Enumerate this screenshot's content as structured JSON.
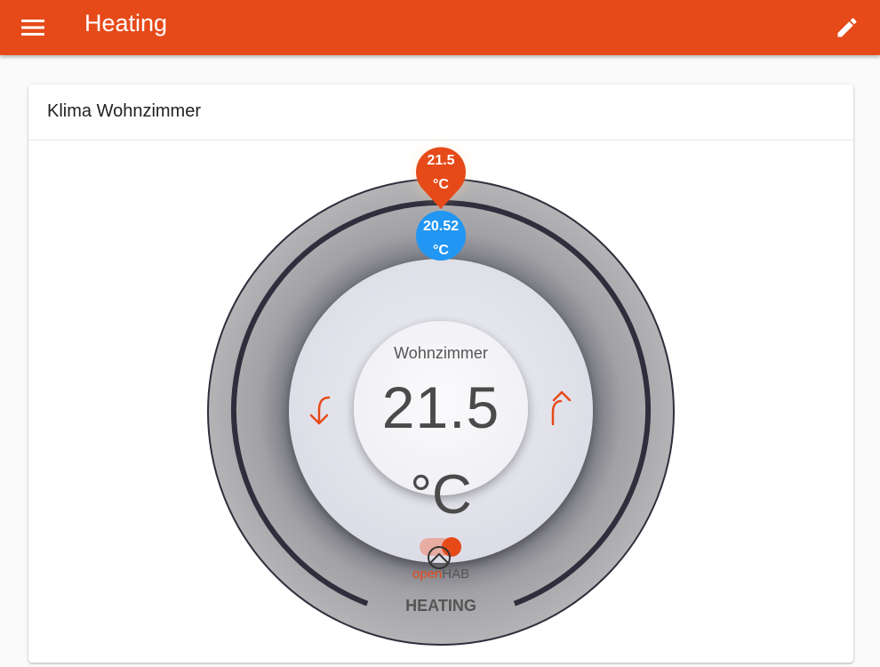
{
  "appbar": {
    "title": "Heating",
    "menu_icon": "menu-icon",
    "edit_icon": "pencil-icon"
  },
  "card": {
    "title": "Klima Wohnzimmer"
  },
  "thermostat": {
    "room": "Wohnzimmer",
    "target_value": "21.5",
    "unit": "°C",
    "target_badge_value": "21.5",
    "target_badge_unit": "°C",
    "current_badge_value": "20.52",
    "current_badge_unit": "°C",
    "mode": "HEATING",
    "logo_open": "open",
    "logo_hab": "HAB",
    "decrease_icon": "arrow-down-icon",
    "increase_icon": "arrow-up-icon"
  },
  "colors": {
    "accent": "#e64a19",
    "current": "#2196f3",
    "ring": "#2f2e3d"
  }
}
